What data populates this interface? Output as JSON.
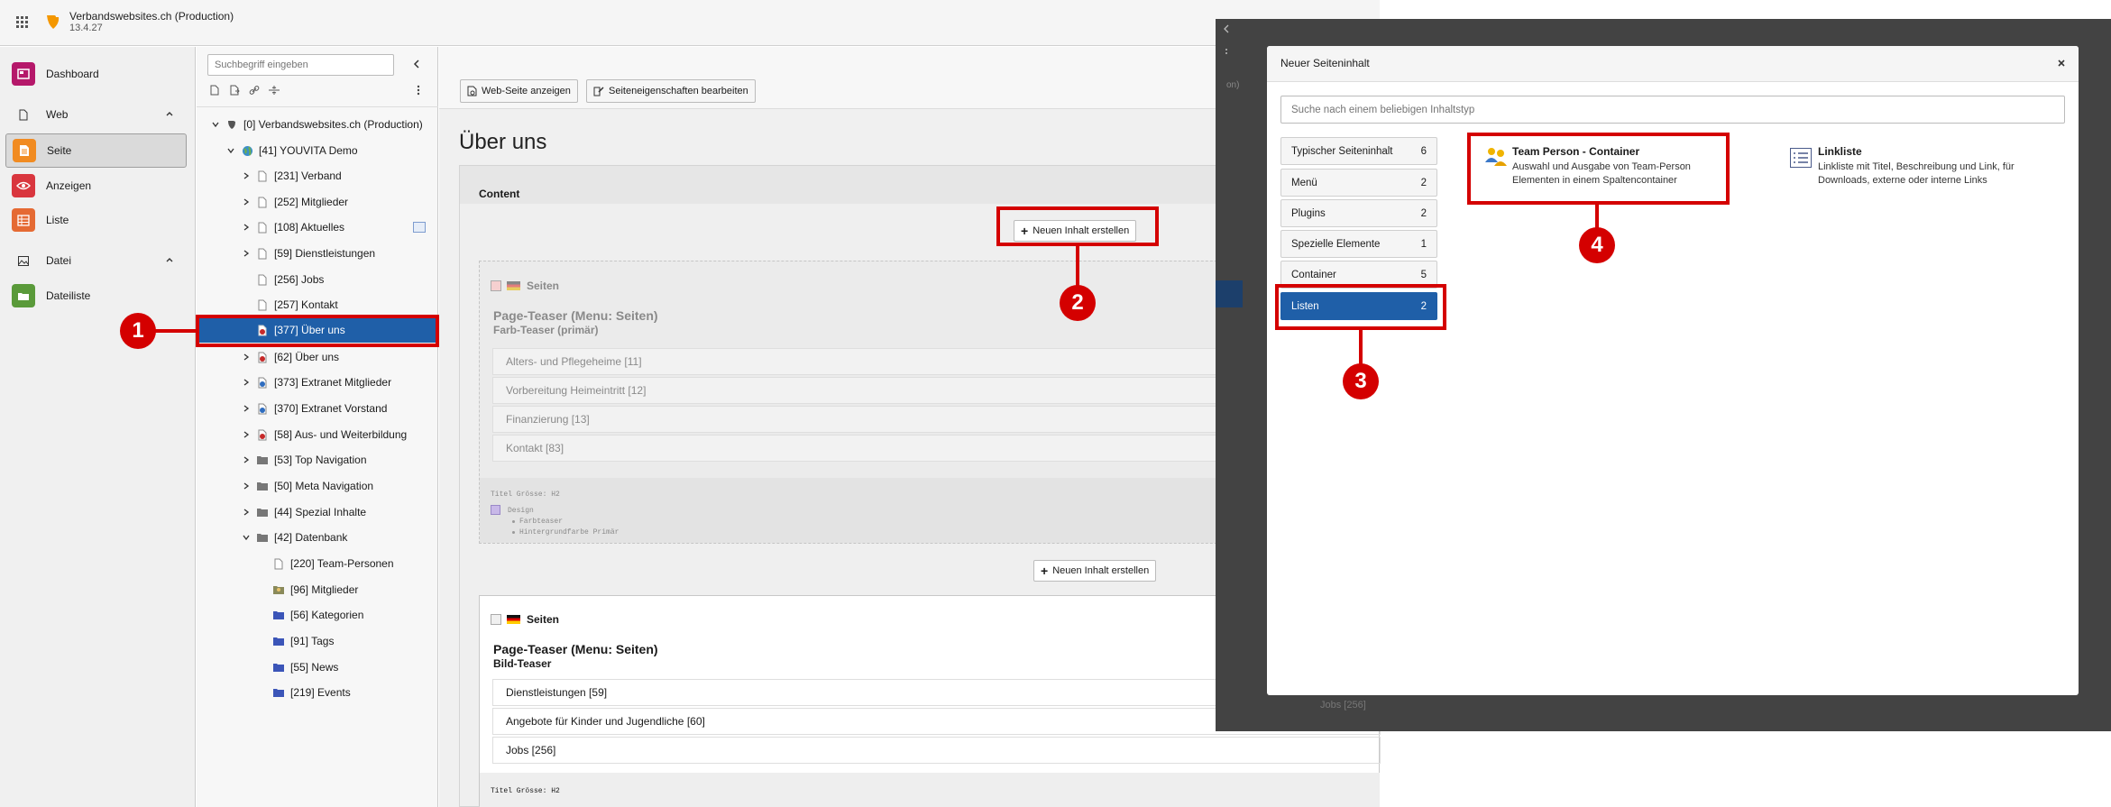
{
  "app": {
    "title": "Verbandswebsites.ch (Production)",
    "version": "13.4.27"
  },
  "modules": {
    "dashboard": "Dashboard",
    "web_group": "Web",
    "seite": "Seite",
    "anzeigen": "Anzeigen",
    "liste": "Liste",
    "datei_group": "Datei",
    "dateiliste": "Dateiliste"
  },
  "tree": {
    "search_placeholder": "Suchbegriff eingeben",
    "items": [
      {
        "label": "[0] Verbandswebsites.ch (Production)"
      },
      {
        "label": "[41] YOUVITA Demo"
      },
      {
        "label": "[231] Verband"
      },
      {
        "label": "[252] Mitglieder"
      },
      {
        "label": "[108] Aktuelles"
      },
      {
        "label": "[59] Dienstleistungen"
      },
      {
        "label": "[256] Jobs"
      },
      {
        "label": "[257] Kontakt"
      },
      {
        "label": "[377] Über uns"
      },
      {
        "label": "[62] Über uns"
      },
      {
        "label": "[373] Extranet Mitglieder"
      },
      {
        "label": "[370] Extranet Vorstand"
      },
      {
        "label": "[58] Aus- und Weiterbildung"
      },
      {
        "label": "[53] Top Navigation"
      },
      {
        "label": "[50] Meta Navigation"
      },
      {
        "label": "[44] Spezial Inhalte"
      },
      {
        "label": "[42] Datenbank"
      },
      {
        "label": "[220] Team-Personen"
      },
      {
        "label": "[96] Mitglieder"
      },
      {
        "label": "[56] Kategorien"
      },
      {
        "label": "[91] Tags"
      },
      {
        "label": "[55] News"
      },
      {
        "label": "[219] Events"
      }
    ]
  },
  "toolbar": {
    "view_page": "Web-Seite anzeigen",
    "edit_props": "Seiteneigenschaften bearbeiten"
  },
  "page": {
    "title": "Über uns",
    "column_title": "Content",
    "new_content_label": "Neuen Inhalt erstellen",
    "element1": {
      "type": "Seiten",
      "header": "Page-Teaser (Menu: Seiten)",
      "subheader": "Farb-Teaser (primär)",
      "rows": [
        "Alters- und Pflegeheime [11]",
        "Vorbereitung Heimeintritt [12]",
        "Finanzierung [13]",
        "Kontakt [83]"
      ],
      "footer_title": "Titel Grösse: H2",
      "design_label": "Design",
      "design_items": [
        "Farbteaser",
        "Hintergrundfarbe Primär"
      ]
    },
    "element2": {
      "type": "Seiten",
      "header": "Page-Teaser (Menu: Seiten)",
      "subheader": "Bild-Teaser",
      "rows": [
        "Dienstleistungen [59]",
        "Angebote für Kinder und Jugendliche [60]",
        "Jobs [256]"
      ],
      "footer_title": "Titel Grösse: H2"
    }
  },
  "background_peek": {
    "text1": "on)",
    "text2": "Jobs [256]"
  },
  "modal": {
    "title": "Neuer Seiteninhalt",
    "search_placeholder": "Suche nach einem beliebigen Inhaltstyp",
    "categories": [
      {
        "label": "Typischer Seiteninhalt",
        "count": "6"
      },
      {
        "label": "Menü",
        "count": "2"
      },
      {
        "label": "Plugins",
        "count": "2"
      },
      {
        "label": "Spezielle Elemente",
        "count": "1"
      },
      {
        "label": "Container",
        "count": "5"
      },
      {
        "label": "Listen",
        "count": "2"
      }
    ],
    "items": [
      {
        "title": "Team Person - Container",
        "desc": "Auswahl und Ausgabe von Team-Person Elementen in einem Spaltencontainer"
      },
      {
        "title": "Linkliste",
        "desc": "Linkliste mit Titel, Beschreibung und Link, für Downloads, externe oder interne Links"
      }
    ]
  },
  "annotations": [
    "1",
    "2",
    "3",
    "4"
  ],
  "colors": {
    "accent": "#1f5fa8",
    "annotation": "#d40000",
    "typo3": "#f49700"
  }
}
